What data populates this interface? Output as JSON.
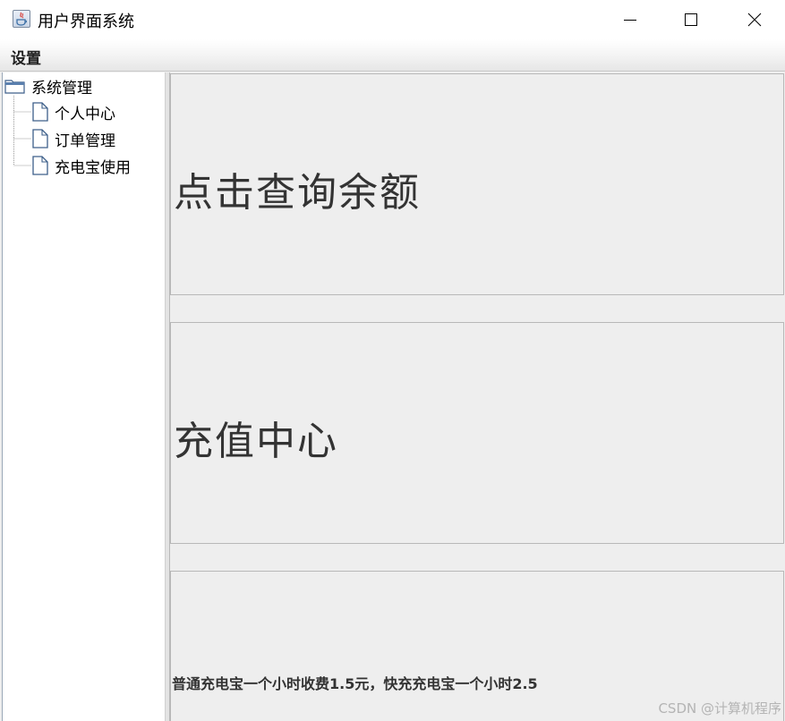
{
  "window": {
    "title": "用户界面系统",
    "minimize_glyph": "—",
    "maximize_glyph": "□",
    "close_glyph": "✕"
  },
  "menubar": {
    "items": [
      {
        "label": "设置"
      }
    ]
  },
  "tree": {
    "root": {
      "label": "系统管理",
      "icon": "folder-icon"
    },
    "children": [
      {
        "label": "个人中心",
        "icon": "document-icon"
      },
      {
        "label": "订单管理",
        "icon": "document-icon"
      },
      {
        "label": "充电宝使用",
        "icon": "document-icon"
      }
    ]
  },
  "panels": {
    "balance_query": "点击查询余额",
    "recharge_center": "充值中心",
    "pricing_info": "普通充电宝一个小时收费1.5元，快充充电宝一个小时2.5"
  },
  "watermark": "CSDN @计算机程序"
}
